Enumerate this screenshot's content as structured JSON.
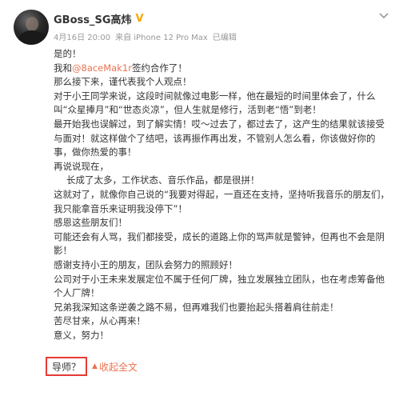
{
  "post": {
    "username": "GBoss_SG高炜",
    "verified_badge": "V",
    "date": "4月16日 20:00",
    "via": "来自 iPhone 12 Pro Max",
    "edited": "已编辑",
    "lines": [
      {
        "text": "是的！"
      },
      {
        "prefix": "我和",
        "mention": "@8aceMak1r",
        "suffix": "签约合作了！"
      },
      {
        "text": "那么接下来，谨代表我个人观点！"
      },
      {
        "text": "对于小王同学来说，这段时间就像过电影一样，他在最短的时间里体会了，什么叫“众星捧月”和“世态炎凉”，但人生就是修行，活到老“悟”到老！"
      },
      {
        "text": "最开始我也误解过，到了解实情！哎～过去了，都过去了，这产生的结果就该接受与面对！就这样做个了结吧，该再振作再出发，不管别人怎么看，你该做好你的事，做你热爱的事！"
      },
      {
        "text": "再说说现在，"
      },
      {
        "text": "长成了太多，工作状态、音乐作品，都是很拼！"
      },
      {
        "text": "这就对了，就像你自己说的“我要对得起，一直还在支持，坚持听我音乐的朋友们，我只能拿音乐来证明我没停下”！"
      },
      {
        "text": "感恩这些朋友们！"
      },
      {
        "text": "可能还会有人骂，我们都接受，成长的道路上你的骂声就是警钟，但再也不会是阴影！"
      },
      {
        "text": "感谢支持小王的朋友，团队会努力的照顾好！"
      },
      {
        "text": "公司对于小王未来发展定位不属于任何厂牌，独立发展独立团队，也在考虑筹备他个人厂牌！"
      },
      {
        "text": "兄弟我深知这条逆袭之路不易，但再难我们也要抬起头搭着肩往前走！"
      },
      {
        "text": "苦尽甘来，从心再来！"
      },
      {
        "text": "意义，努力！"
      }
    ],
    "mentor_label": "导师？",
    "collapse_label": "收起全文",
    "collapse_arrow": "▲"
  },
  "icons": {
    "avatar": "user-avatar",
    "menu": "chevron-down-icon",
    "collapse": "up-caret-icon"
  },
  "colors": {
    "accent": "#eb7350",
    "verified": "#f7a800",
    "meta": "#999999",
    "highlight_box": "#e53a35"
  }
}
